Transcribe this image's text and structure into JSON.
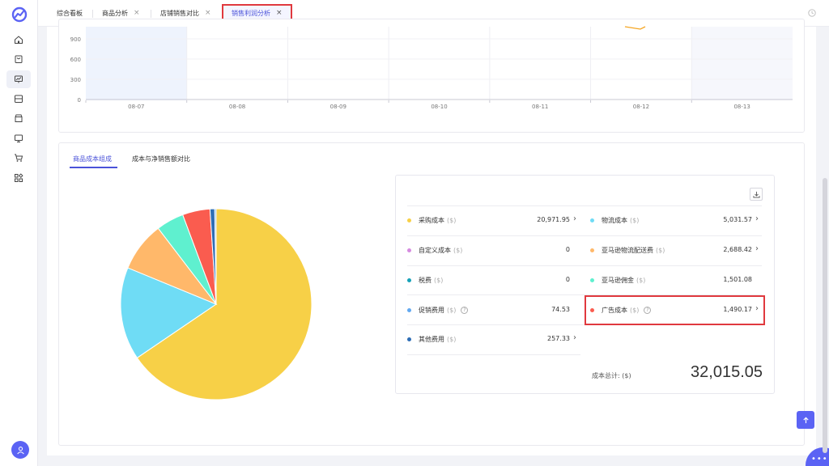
{
  "tabs": [
    {
      "label": "综合看板",
      "closable": false,
      "active": false
    },
    {
      "label": "商品分析",
      "closable": true,
      "active": false
    },
    {
      "label": "店铺销售对比",
      "closable": true,
      "active": false
    },
    {
      "label": "销售利润分析",
      "closable": true,
      "active": true
    }
  ],
  "close_glyph": "×",
  "sidebar": {
    "items": [
      "home-icon",
      "bag-icon",
      "chart-screen-icon",
      "store-icon",
      "shop-icon",
      "monitor-icon",
      "cart-icon",
      "apps-icon"
    ],
    "active_index": 2
  },
  "trend_chart": {
    "y_ticks": [
      "900",
      "600",
      "300",
      "0"
    ],
    "x_ticks": [
      "08-07",
      "08-08",
      "08-09",
      "08-10",
      "08-11",
      "08-12",
      "08-13"
    ]
  },
  "section_tabs": [
    "商品成本组成",
    "成本与净销售额对比"
  ],
  "cost_table": {
    "left": [
      {
        "label": "采购成本",
        "unit": "($)",
        "value": "20,971.95",
        "color": "#f7d047",
        "arrow": true,
        "help": false
      },
      {
        "label": "自定义成本",
        "unit": "($)",
        "value": "0",
        "color": "#d68be0",
        "arrow": false,
        "help": false
      },
      {
        "label": "税费",
        "unit": "($)",
        "value": "0",
        "color": "#17a2b8",
        "arrow": false,
        "help": false
      },
      {
        "label": "促销费用",
        "unit": "($)",
        "value": "74.53",
        "color": "#63a9f0",
        "arrow": false,
        "help": true
      },
      {
        "label": "其他费用",
        "unit": "($)",
        "value": "257.33",
        "color": "#2d6db5",
        "arrow": true,
        "help": false
      }
    ],
    "right": [
      {
        "label": "物流成本",
        "unit": "($)",
        "value": "5,031.57",
        "color": "#6fdcf5",
        "arrow": true,
        "help": false
      },
      {
        "label": "亚马逊物流配送费",
        "unit": "($)",
        "value": "2,688.42",
        "color": "#ffb86a",
        "arrow": true,
        "help": false
      },
      {
        "label": "亚马逊佣金",
        "unit": "($)",
        "value": "1,501.08",
        "color": "#5ff0cf",
        "arrow": false,
        "help": false
      },
      {
        "label": "广告成本",
        "unit": "($)",
        "value": "1,490.17",
        "color": "#fa5c4f",
        "arrow": true,
        "help": true
      }
    ],
    "total_label": "成本总计: ($)",
    "total_value": "32,015.05",
    "arrow_glyph": "›",
    "help_glyph": "?"
  },
  "chart_data": {
    "type": "pie",
    "slices": [
      {
        "name": "采购成本",
        "value": 20971.95,
        "color": "#f7d047"
      },
      {
        "name": "物流成本",
        "value": 5031.57,
        "color": "#6fdcf5"
      },
      {
        "name": "亚马逊物流配送费",
        "value": 2688.42,
        "color": "#ffb86a"
      },
      {
        "name": "亚马逊佣金",
        "value": 1501.08,
        "color": "#5ff0cf"
      },
      {
        "name": "广告成本",
        "value": 1490.17,
        "color": "#fa5c4f"
      },
      {
        "name": "其他费用",
        "value": 257.33,
        "color": "#2d6db5"
      },
      {
        "name": "促销费用",
        "value": 74.53,
        "color": "#63a9f0"
      }
    ],
    "legend": "none"
  },
  "colors": {
    "accent": "#4a52d9",
    "highlight": "#e0393e",
    "line": "#f5a623"
  }
}
